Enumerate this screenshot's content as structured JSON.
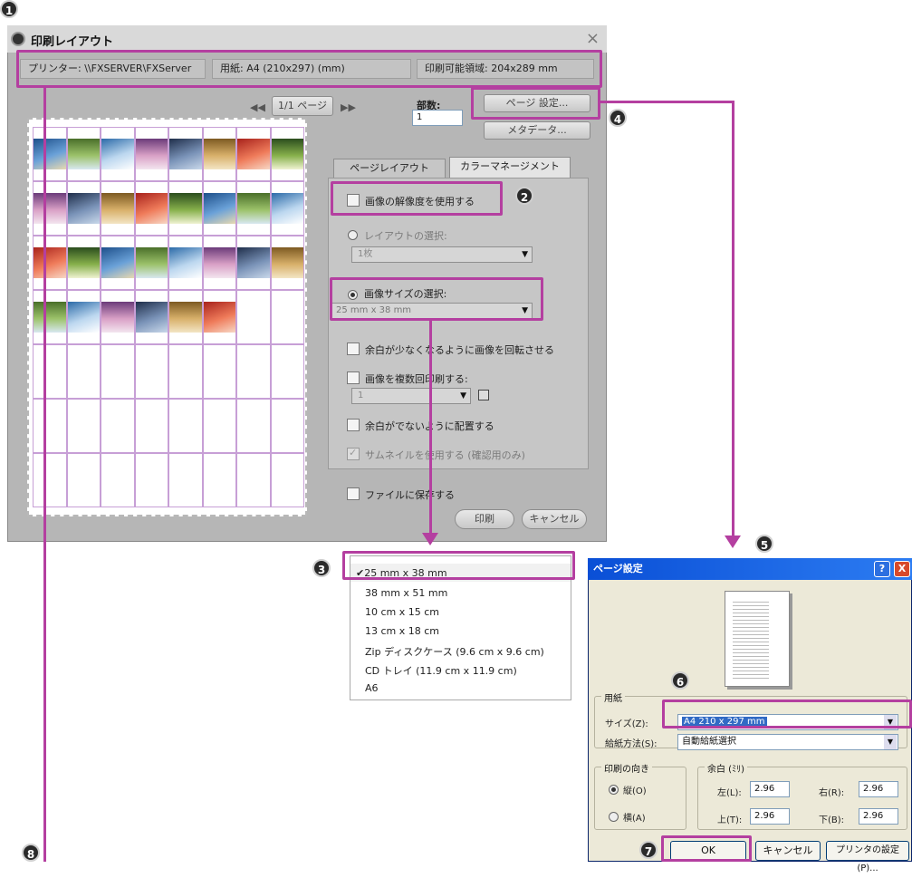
{
  "steps": [
    "1",
    "2",
    "3",
    "4",
    "5",
    "6",
    "7",
    "8"
  ],
  "main": {
    "title": "印刷レイアウト",
    "close": "×",
    "printer": "プリンター: \\\\FXSERVER\\FXServer",
    "paper": "用紙: A4 (210x297) (mm)",
    "printable": "印刷可能領域: 204x289 mm",
    "page_prev": "◀◀",
    "page_label": "1/1 ページ",
    "page_next": "▶▶",
    "copies_label": "部数:",
    "copies_value": "1",
    "page_setup_button": "ページ 設定...",
    "metadata_button": "メタデータ...",
    "tabs": [
      "ページレイアウト",
      "カラーマネージメント"
    ],
    "use_resolution": "画像の解像度を使用する",
    "layout_select_label": "レイアウトの選択:",
    "layout_select_value": "1枚",
    "image_size_label": "画像サイズの選択:",
    "image_size_value": "25 mm x 38 mm",
    "rotate_label": "余白が少なくなるように画像を回転させる",
    "multi_print_label": "画像を複数回印刷する:",
    "multi_print_value": "1",
    "no_margin_label": "余白がでないように配置する",
    "thumbnail_label": "サムネイルを使用する (確認用のみ)",
    "save_to_file_label": "ファイルに保存する",
    "print_button": "印刷",
    "cancel_button": "キャンセル"
  },
  "size_options": [
    "✔25 mm x 38 mm",
    "38 mm x 51 mm",
    "10 cm x 15 cm",
    "13 cm x 18 cm",
    "Zip ディスクケース (9.6 cm x 9.6 cm)",
    "CD トレイ (11.9 cm x 11.9 cm)",
    "A6"
  ],
  "page_setup": {
    "title": "ページ設定",
    "help": "?",
    "close": "X",
    "paper_group": "用紙",
    "size_label": "サイズ(Z):",
    "size_value": "A4 210 x 297 mm",
    "source_label": "給紙方法(S):",
    "source_value": "自動給紙選択",
    "orientation_group": "印刷の向き",
    "portrait": "縦(O)",
    "landscape": "横(A)",
    "margin_group": "余白 (ﾐﾘ)",
    "left_label": "左(L):",
    "left_value": "2.96",
    "right_label": "右(R):",
    "right_value": "2.96",
    "top_label": "上(T):",
    "top_value": "2.96",
    "bottom_label": "下(B):",
    "bottom_value": "2.96",
    "ok": "OK",
    "cancel": "キャンセル",
    "printer_settings": "プリンタの設定(P)..."
  },
  "colors": {
    "highlight": "#b43fa0",
    "dialog_bg": "#b6b6b6",
    "xp_title": "#0a4fd6"
  }
}
